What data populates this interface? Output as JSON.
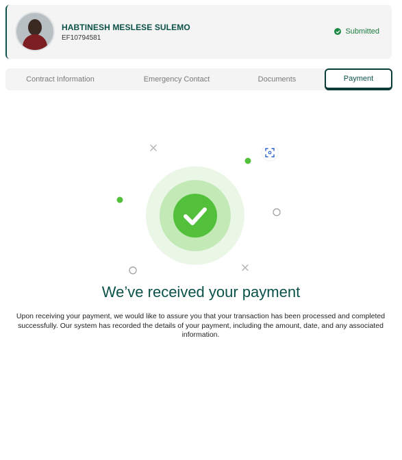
{
  "header": {
    "name": "HABTINESH MESLESE SULEMO",
    "id": "EF10794581",
    "status": "Submitted"
  },
  "tabs": [
    {
      "label": "Contract Information"
    },
    {
      "label": "Emergency Contact"
    },
    {
      "label": "Documents"
    },
    {
      "label": "Payment",
      "active": true
    }
  ],
  "confirmation": {
    "headline": "We’ve received your payment",
    "description": "Upon receiving your payment, we would like to assure you that your transaction has been processed and completed successfully. Our system has recorded the details of your payment, including the amount, date, and any associated information."
  },
  "colors": {
    "brand": "#0b5149",
    "success": "#52c03a",
    "status_green": "#1a8a43"
  }
}
